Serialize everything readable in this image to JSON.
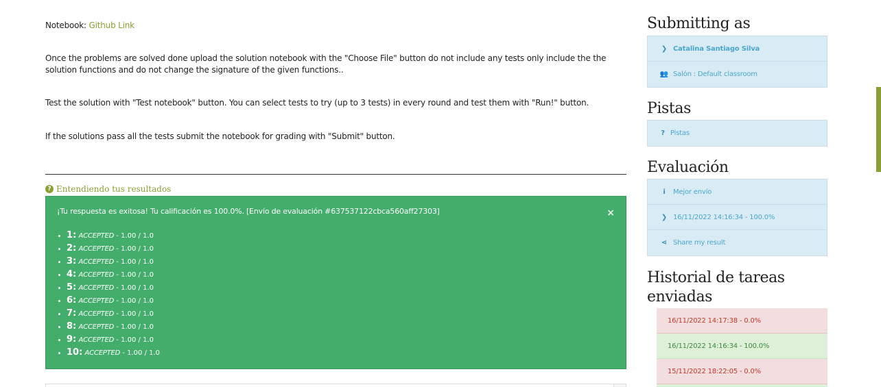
{
  "main": {
    "notebook_label": "Notebook: ",
    "notebook_link": "Github Link",
    "upload_text": "Once the problems are solved done upload the solution notebook with the \"Choose File\" button do not include any tests only include the the solution functions and do not change the signature of the given functions..",
    "test_text": "Test the solution with \"Test notebook\" button. You can select tests to try (up to 3 tests) in every round and test them with \"Run!\" button.",
    "submit_text": "If the solutions pass all the tests submit the notebook for grading with \"Submit\" button.",
    "understand_label": "Entendiendo tus resultados",
    "alert": {
      "message": "¡Tu respuesta es exitosa! Tu calificación es 100.0%. [Envío de evaluación #637537122cbca560aff27303]",
      "close": "×",
      "results": [
        {
          "num": "1:",
          "status": "ACCEPTED",
          "score": " - 1.00 / 1.0"
        },
        {
          "num": "2:",
          "status": "ACCEPTED",
          "score": " - 1.00 / 1.0"
        },
        {
          "num": "3:",
          "status": "ACCEPTED",
          "score": " - 1.00 / 1.0"
        },
        {
          "num": "4:",
          "status": "ACCEPTED",
          "score": " - 1.00 / 1.0"
        },
        {
          "num": "5:",
          "status": "ACCEPTED",
          "score": " - 1.00 / 1.0"
        },
        {
          "num": "6:",
          "status": "ACCEPTED",
          "score": " - 1.00 / 1.0"
        },
        {
          "num": "7:",
          "status": "ACCEPTED",
          "score": " - 1.00 / 1.0"
        },
        {
          "num": "8:",
          "status": "ACCEPTED",
          "score": " - 1.00 / 1.0"
        },
        {
          "num": "9:",
          "status": "ACCEPTED",
          "score": " - 1.00 / 1.0"
        },
        {
          "num": "10:",
          "status": "ACCEPTED",
          "score": " - 1.00 / 1.0"
        }
      ]
    }
  },
  "sidebar": {
    "submitting_title": "Submitting as",
    "user_name": "Catalina Santiago Silva",
    "classroom": "Salón : Default classroom",
    "hints_title": "Pistas",
    "hints_item": "Pistas",
    "eval_title": "Evaluación",
    "best_submission": "Mejor envío",
    "best_result": "16/11/2022 14:16:34 - 100.0%",
    "share": "Share my result",
    "history_title": "Historial de tareas enviadas",
    "history": [
      {
        "label": "16/11/2022 14:17:38 - 0.0%",
        "status": "fail"
      },
      {
        "label": "16/11/2022 14:16:34 - 100.0%",
        "status": "ok"
      },
      {
        "label": "15/11/2022 18:22:05 - 0.0%",
        "status": "fail"
      }
    ]
  },
  "colors": {
    "accent": "#8aa036",
    "success": "#43ad6b",
    "info_bg": "#d9ecf6",
    "info_text": "#4ba6cd",
    "fail_bg": "#f2dede",
    "fail_text": "#c0392b",
    "ok_bg": "#dff0d8"
  }
}
